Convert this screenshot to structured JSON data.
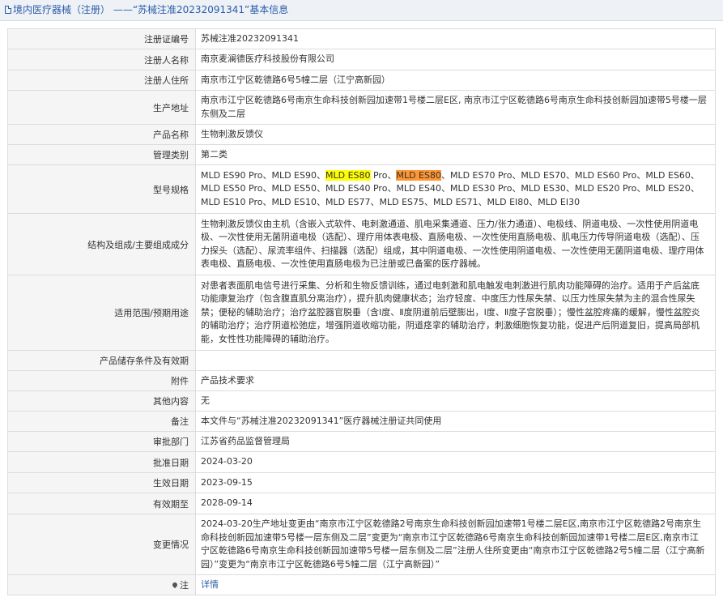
{
  "header": {
    "title": "境内医疗器械（注册） ——“苏械注准20232091341”基本信息"
  },
  "fields": {
    "reg_no": {
      "label": "注册证编号",
      "value": "苏械注准20232091341"
    },
    "registrant": {
      "label": "注册人名称",
      "value": "南京麦澜德医疗科技股份有限公司"
    },
    "reg_addr": {
      "label": "注册人住所",
      "value": "南京市江宁区乾德路6号5幢二层（江宁高新园）"
    },
    "prod_addr": {
      "label": "生产地址",
      "value": "南京市江宁区乾德路6号南京生命科技创新园加速带1号楼二层E区, 南京市江宁区乾德路6号南京生命科技创新园加速带5号楼一层东侧及二层"
    },
    "product_name": {
      "label": "产品名称",
      "value": "生物刺激反馈仪"
    },
    "category": {
      "label": "管理类别",
      "value": "第二类"
    },
    "models": {
      "label": "型号规格",
      "part1": "MLD ES90 Pro、MLD ES90、",
      "hl1": "MLD ES80",
      "part2": " Pro、",
      "hl2": "MLD ES80",
      "part3": "、MLD ES70 Pro、MLD ES70、MLD ES60 Pro、MLD ES60、MLD ES50 Pro、MLD ES50、MLD ES40 Pro、MLD ES40、MLD ES30 Pro、MLD ES30、MLD ES20 Pro、MLD ES20、MLD ES10 Pro、MLD ES10、MLD ES77、MLD ES75、MLD ES71、MLD EI80、MLD EI30"
    },
    "structure": {
      "label": "结构及组成/主要组成成分",
      "value": "生物刺激反馈仪由主机（含嵌入式软件、电刺激通道、肌电采集通道、压力/张力通道）、电极线、阴道电极、一次性使用阴道电极、一次性使用无菌阴道电极（选配）、理疗用体表电极、直肠电极、一次性使用直肠电极、肌电压力传导阴道电极（选配）、压力探头（选配）、尿流率组件、扫描器（选配）组成，其中阴道电极、一次性使用阴道电极、一次性使用无菌阴道电极、理疗用体表电极、直肠电极、一次性使用直肠电极为已注册或已备案的医疗器械。"
    },
    "scope": {
      "label": "适用范围/预期用途",
      "value": "对患者表面肌电信号进行采集、分析和生物反馈训练，通过电刺激和肌电触发电刺激进行肌肉功能障碍的治疗。适用于产后盆底功能康复治疗（包含腹直肌分离治疗），提升肌肉健康状态；治疗轻度、中度压力性尿失禁、以压力性尿失禁为主的混合性尿失禁；便秘的辅助治疗；治疗盆腔器官脱垂（含Ⅰ度、Ⅱ度阴道前后壁膨出，Ⅰ度、Ⅱ度子宫脱垂）；慢性盆腔疼痛的缓解，慢性盆腔炎的辅助治疗；治疗阴道松弛症，增强阴道收缩功能，阴道痉挛的辅助治疗，刺激细胞恢复功能，促进产后阴道复旧，提高局部机能，女性性功能障碍的辅助治疗。"
    },
    "storage": {
      "label": "产品储存条件及有效期",
      "value": ""
    },
    "attachment": {
      "label": "附件",
      "value": "产品技术要求"
    },
    "other": {
      "label": "其他内容",
      "value": "无"
    },
    "remark": {
      "label": "备注",
      "value": "本文件与“苏械注准20232091341”医疗器械注册证共同使用"
    },
    "authority": {
      "label": "审批部门",
      "value": "江苏省药品监督管理局"
    },
    "approval": {
      "label": "批准日期",
      "value": "2024-03-20"
    },
    "effective": {
      "label": "生效日期",
      "value": "2023-09-15"
    },
    "expiry": {
      "label": "有效期至",
      "value": "2028-09-14"
    },
    "changes": {
      "label": "变更情况",
      "value": "2024-03-20生产地址变更由“南京市江宁区乾德路2号南京生命科技创新园加速带1号楼二层E区,南京市江宁区乾德路2号南京生命科技创新园加速带5号楼一层东侧及二层”变更为“南京市江宁区乾德路6号南京生命科技创新园加速带1号楼二层E区,南京市江宁区乾德路6号南京生命科技创新园加速带5号楼一层东侧及二层”注册人住所变更由“南京市江宁区乾德路2号5幢二层（江宁高新园）”变更为“南京市江宁区乾德路6号5幢二层（江宁高新园）”"
    },
    "note": {
      "label": "注",
      "link": "详情"
    }
  },
  "colors": {
    "highlight_primary": "#ffff00",
    "highlight_current": "#ff9632",
    "link": "#2a5ca8"
  }
}
